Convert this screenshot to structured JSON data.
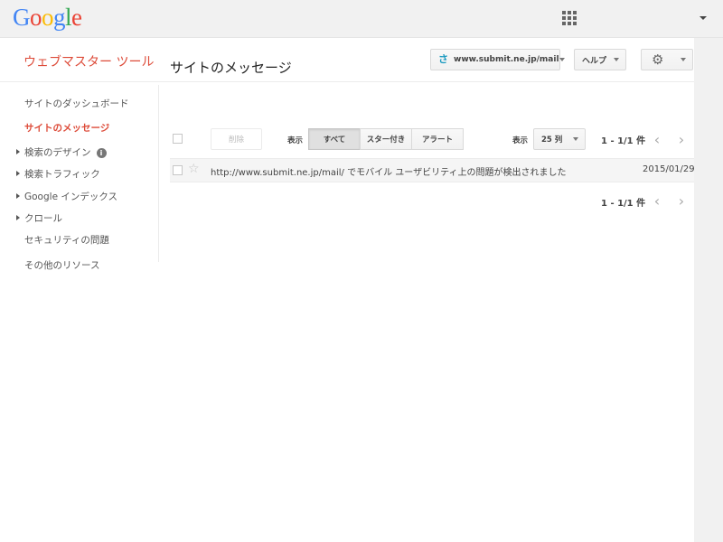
{
  "gbar": {
    "logo_letters": [
      "G",
      "o",
      "o",
      "g",
      "l",
      "e"
    ],
    "logo_colors": [
      "#4285f4",
      "#ea4335",
      "#fbbc05",
      "#4285f4",
      "#34a853",
      "#ea4335"
    ]
  },
  "header": {
    "app_title": "ウェブマスター ツール",
    "site_selector": "www.submit.ne.jp/mail",
    "help_label": "ヘルプ",
    "settings_icon": "gear-icon"
  },
  "sidebar": {
    "items": [
      {
        "label": "サイトのダッシュボード",
        "active": false,
        "expandable": false
      },
      {
        "label": "サイトのメッセージ",
        "active": true,
        "expandable": false
      },
      {
        "label": "検索のデザイン",
        "active": false,
        "expandable": true,
        "info": "i"
      },
      {
        "label": "検索トラフィック",
        "active": false,
        "expandable": true
      },
      {
        "label": "Google インデックス",
        "active": false,
        "expandable": true
      },
      {
        "label": "クロール",
        "active": false,
        "expandable": true
      },
      {
        "label": "セキュリティの問題",
        "active": false,
        "expandable": false
      },
      {
        "label": "その他のリソース",
        "active": false,
        "expandable": false
      }
    ]
  },
  "main": {
    "heading": "サイトのメッセージ",
    "toolbar": {
      "delete_label": "削除",
      "filter_label": "表示",
      "filters": [
        "すべて",
        "スター付き",
        "アラート"
      ],
      "active_filter": "すべて",
      "per_page_label": "表示",
      "per_page_value": "25 列",
      "pagination": "1 - 1/1 件"
    },
    "messages": [
      {
        "text": "http://www.submit.ne.jp/mail/ でモバイル ユーザビリティ上の問題が検出されました",
        "date": "2015/01/29",
        "starred": false
      }
    ],
    "bottom_pagination": "1 - 1/1 件"
  },
  "colors": {
    "accent": "#dd4b39",
    "site_icon": "#1a9ac0"
  }
}
